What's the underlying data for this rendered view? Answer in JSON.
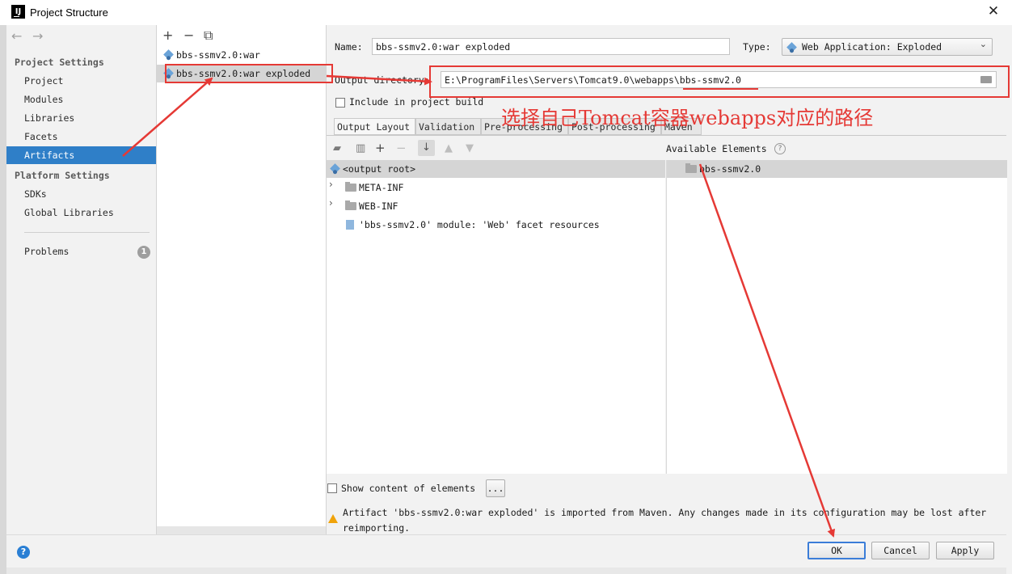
{
  "window": {
    "title": "Project Structure",
    "close": "✕"
  },
  "nav": {
    "back": "←",
    "forward": "→"
  },
  "sidebar": {
    "project_settings_header": "Project Settings",
    "project_items": [
      {
        "label": "Project"
      },
      {
        "label": "Modules"
      },
      {
        "label": "Libraries"
      },
      {
        "label": "Facets"
      },
      {
        "label": "Artifacts",
        "selected": true
      }
    ],
    "platform_settings_header": "Platform Settings",
    "platform_items": [
      {
        "label": "SDKs"
      },
      {
        "label": "Global Libraries"
      }
    ],
    "problems": {
      "label": "Problems",
      "count": "1"
    }
  },
  "artifacts": {
    "toolbar": {
      "add": "+",
      "remove": "−",
      "copy": "⧉"
    },
    "items": [
      {
        "label": "bbs-ssmv2.0:war"
      },
      {
        "label": "bbs-ssmv2.0:war exploded",
        "selected": true
      }
    ]
  },
  "detail": {
    "name_label": "Name:",
    "name_value": "bbs-ssmv2.0:war exploded",
    "type_label": "Type:",
    "type_value": "Web Application: Exploded",
    "output_dir_label": "Output directory:",
    "output_dir_value": "E:\\ProgramFiles\\Servers\\Tomcat9.0\\webapps\\bbs-ssmv2.0",
    "include_build_label": "Include in project build",
    "tabs": [
      "Output Layout",
      "Validation",
      "Pre-processing",
      "Post-processing",
      "Maven"
    ],
    "available_elements_label": "Available Elements",
    "tree": [
      {
        "label": "<output root>"
      },
      {
        "label": "META-INF"
      },
      {
        "label": "WEB-INF"
      },
      {
        "label": "'bbs-ssmv2.0' module: 'Web' facet resources"
      }
    ],
    "available_items": [
      {
        "label": "bbs-ssmv2.0"
      }
    ],
    "show_content_label": "Show content of elements",
    "more_button": "...",
    "warning_line1": "Artifact 'bbs-ssmv2.0:war exploded' is imported from Maven. Any changes made in its configuration may be lost after",
    "warning_line2": "reimporting."
  },
  "annotation": {
    "text": "选择自己Tomcat容器webapps对应的路径",
    "color": "#e53935"
  },
  "buttons": {
    "ok": "OK",
    "cancel": "Cancel",
    "apply": "Apply",
    "help": "?"
  },
  "colors": {
    "selection": "#2f7fc8",
    "accent": "#3b7dd8",
    "annotation": "#e53935"
  }
}
